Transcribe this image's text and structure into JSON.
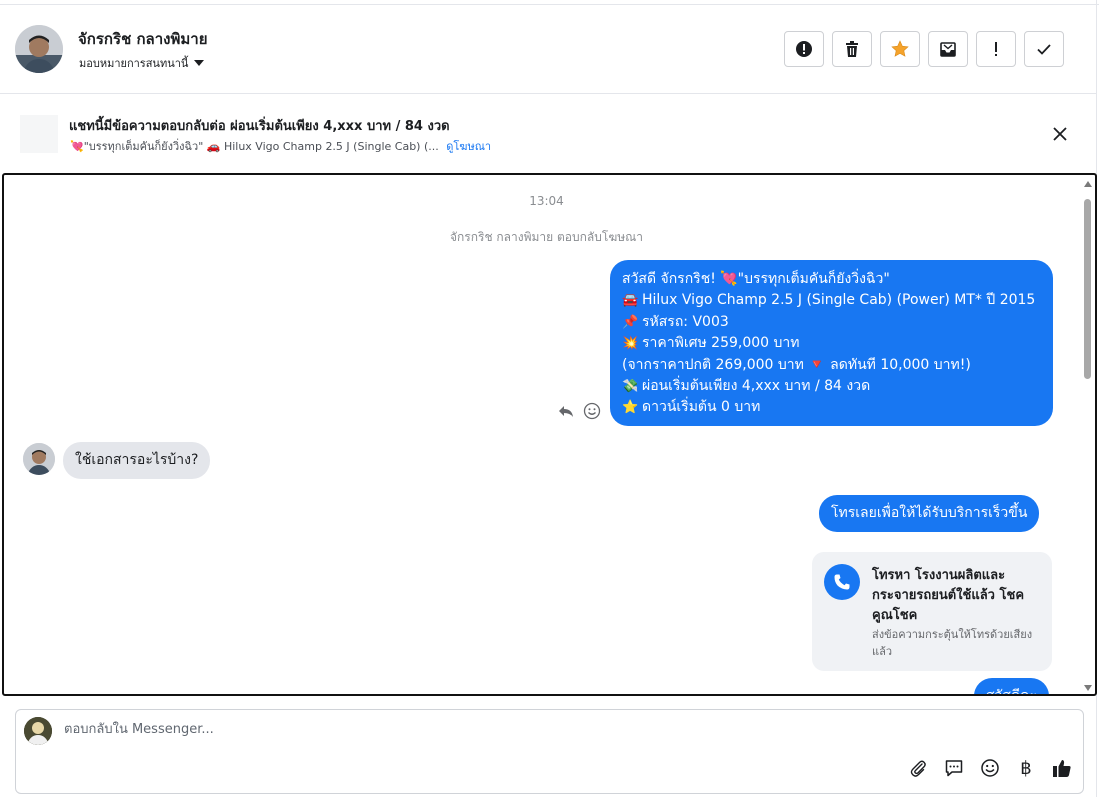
{
  "header": {
    "contact_name": "จักรกริช กลางพิมาย",
    "assign_label": "มอบหมายการสนทนานี้",
    "toolbar_icons": [
      "report-icon",
      "trash-icon",
      "star-icon",
      "mark-unread-icon",
      "important-icon",
      "check-icon"
    ]
  },
  "ad_bar": {
    "title": "แชทนี้มีข้อความตอบกลับต่อ ผ่อนเริ่มต้นเพียง 4,xxx บาท / 84 งวด",
    "subtitle": "💘\"บรรทุกเต็มคันก็ยังวิ่งฉิว\" 🚗 Hilux Vigo Champ 2.5 J (Single Cab) (...",
    "link": "ดูโฆษณา"
  },
  "conversation": {
    "timestamp": "13:04",
    "system_message": "จักรกริช กลางพิมาย ตอบกลับโฆษณา",
    "outgoing_1": {
      "lines": [
        {
          "emoji": "",
          "text": "สวัสดี จักรกริช! 💘\"บรรทุกเต็มคันก็ยังวิ่งฉิว\""
        },
        {
          "emoji": "🚘",
          "text": "Hilux Vigo Champ 2.5 J (Single Cab) (Power) MT* ปี 2015"
        },
        {
          "emoji": "📌",
          "text": "รหัสรถ: V003"
        },
        {
          "emoji": "💥",
          "text": "ราคาพิเศษ 259,000 บาท"
        },
        {
          "emoji": "",
          "text": "(จากราคาปกติ 269,000 บาท 🔻 ลดทันที 10,000 บาท!)"
        },
        {
          "emoji": "💸",
          "text": "ผ่อนเริ่มต้นเพียง 4,xxx บาท / 84 งวด"
        },
        {
          "emoji": "⭐",
          "text": "ดาวน์เริ่มต้น 0 บาท"
        }
      ]
    },
    "incoming_1": "ใช้เอกสารอะไรบ้าง?",
    "outgoing_2": "โทรเลยเพื่อให้ได้รับบริการเร็วขึ้น",
    "call_card": {
      "title": "โทรหา โรงงานผลิตและกระจายรถยนต์ใช้แล้ว โชคคูณโชค",
      "subtitle": "ส่งข้อความกระตุ้นให้โทรด้วยเสียงแล้ว"
    },
    "outgoing_3": "สวัสดีคะ"
  },
  "composer": {
    "placeholder": "ตอบกลับใน Messenger...",
    "tool_icons": [
      "attach-icon",
      "saved-reply-icon",
      "emoji-icon",
      "baht-icon",
      "like-icon"
    ],
    "baht_symbol": "฿"
  }
}
